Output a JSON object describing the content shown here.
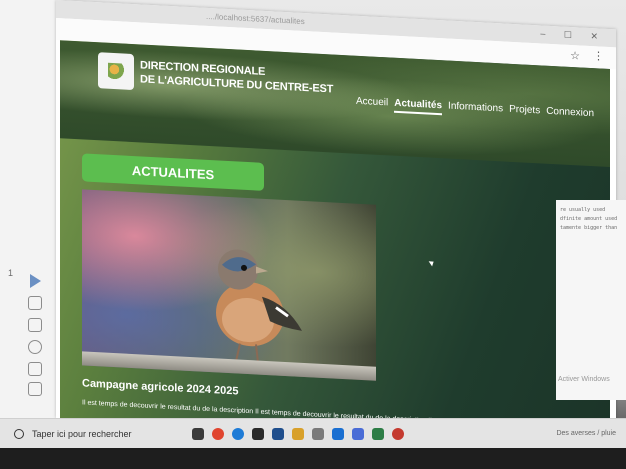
{
  "browser": {
    "url_fragment": "..../localhost:5637/actualites",
    "window_controls": "–  ☐  ✕"
  },
  "site": {
    "brand_line1": "DIRECTION REGIONALE",
    "brand_line2": "DE L'AGRICULTURE DU CENTRE-EST",
    "nav": [
      {
        "label": "Accueil",
        "active": false
      },
      {
        "label": "Actualités",
        "active": true
      },
      {
        "label": "Informations",
        "active": false
      },
      {
        "label": "Projets",
        "active": false
      },
      {
        "label": "Connexion",
        "active": false
      }
    ],
    "section_title": "ACTUALITES",
    "news": {
      "title": "Campagne agricole 2024 2025",
      "excerpt": "Il est temps de decouvrir le resultat du de la description Il est temps de decouvrir le resultat du de la description Il est temps de"
    }
  },
  "editor_left": {
    "line_number": "1"
  },
  "editor_right": {
    "code_lines": [
      "re usually used",
      "",
      "dfinite amount used",
      "tamente bigger than",
      "",
      ""
    ],
    "activate_text": "Activer Windows"
  },
  "taskbar": {
    "search_placeholder": "Taper ici pour rechercher",
    "tray_text": "Des averses / pluie"
  },
  "colors": {
    "accent_green": "#5cbe4f",
    "site_dark_green": "#1f3c2d",
    "site_light_green": "#7b9a4d"
  }
}
